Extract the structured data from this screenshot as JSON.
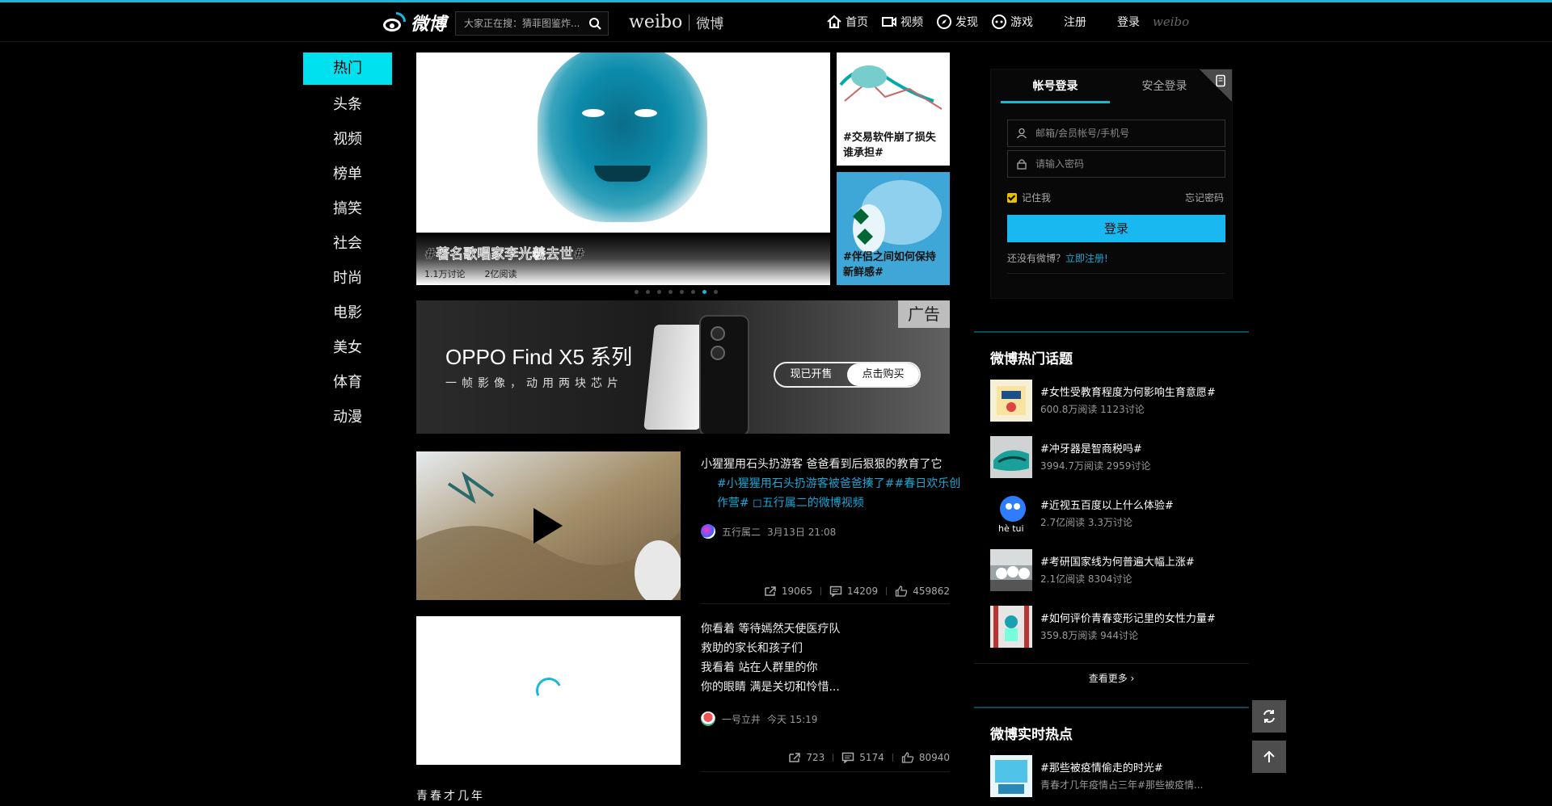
{
  "header": {
    "logo_text": "微博",
    "search_placeholder": "大家正在搜：猜菲图鉴炸...",
    "brand_en": "weibo",
    "brand_zh": "微博",
    "nav": [
      {
        "label": "首页",
        "icon": "home-icon"
      },
      {
        "label": "视频",
        "icon": "video-icon"
      },
      {
        "label": "发现",
        "icon": "compass-icon"
      },
      {
        "label": "游戏",
        "icon": "gamepad-icon"
      }
    ],
    "register": "注册",
    "login": "登录",
    "weibo_small": "weibo"
  },
  "sidebar": {
    "items": [
      "热门",
      "头条",
      "视频",
      "榜单",
      "搞笑",
      "社会",
      "时尚",
      "电影",
      "美女",
      "体育",
      "动漫"
    ],
    "active_index": 0
  },
  "hero": {
    "title": "#著名歌唱家李光羲去世#",
    "discussions": "1.1万讨论",
    "reads": "2亿阅读",
    "side_cards": [
      {
        "title": "#交易软件崩了损失谁承担#"
      },
      {
        "title": "#伴侣之间如何保持新鲜感#"
      }
    ],
    "dot_count": 8,
    "active_dot": 6
  },
  "ad": {
    "title": "OPPO Find X5 系列",
    "subtitle": "一帧影像，动用两块芯片",
    "badge": "广告",
    "pill_left": "现已开售",
    "pill_right": "点击购买"
  },
  "feed": [
    {
      "text": "小猩猩用石头扔游客 爸爸看到后狠狠的教育了它",
      "topics": "#小猩猩用石头扔游客被爸爸揍了##春日欢乐创作营# ◻五行属二的微博视频",
      "author": "五行属二",
      "time": "3月13日 21:08",
      "shares": "19065",
      "comments": "14209",
      "likes": "459862"
    },
    {
      "text": "你看着 等待嫣然天使医疗队\n救助的家长和孩子们\n我看着 站在人群里的你\n你的眼睛 满是关切和怜惜...",
      "author": "一号立井",
      "time": "今天 15:19",
      "shares": "723",
      "comments": "5174",
      "likes": "80940"
    }
  ],
  "bottom_title": "青春才几年",
  "login": {
    "tab_account": "帐号登录",
    "tab_secure": "安全登录",
    "user_placeholder": "邮箱/会员帐号/手机号",
    "pass_placeholder": "请输入密码",
    "remember": "记住我",
    "forgot": "忘记密码",
    "button": "登录",
    "no_account": "还没有微博？",
    "register_link": "立即注册!"
  },
  "hot_topics": {
    "title": "微博热门话题",
    "items": [
      {
        "name": "#女性受教育程度为何影响生育意愿#",
        "meta": "600.8万阅读 1123讨论"
      },
      {
        "name": "#冲牙器是智商税吗#",
        "meta": "3994.7万阅读 2959讨论"
      },
      {
        "name": "#近视五百度以上什么体验#",
        "meta": "2.7亿阅读 3.3万讨论"
      },
      {
        "name": "#考研国家线为何普遍大幅上涨#",
        "meta": "2.1亿阅读 8304讨论"
      },
      {
        "name": "#如何评价青春变形记里的女性力量#",
        "meta": "359.8万阅读 944讨论"
      }
    ],
    "more": "查看更多 ›"
  },
  "realtime": {
    "title": "微博实时热点",
    "items": [
      {
        "name": "#那些被疫情偷走的时光#",
        "meta": "青春才几年疫情占三年#那些被疫情..."
      }
    ]
  },
  "pic3_text": "hè tui"
}
